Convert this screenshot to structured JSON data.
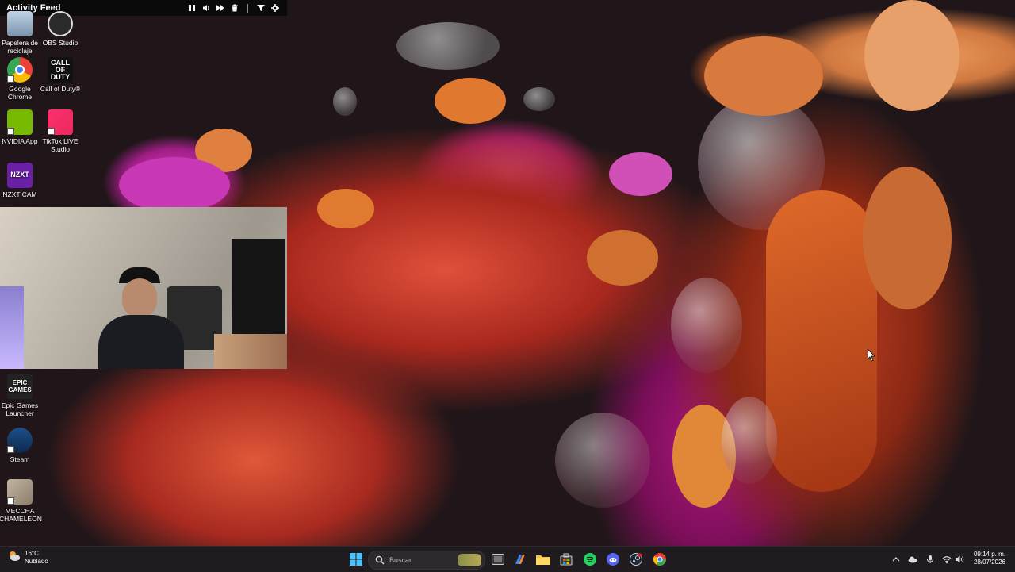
{
  "activity_feed": {
    "title": "Activity Feed",
    "controls": [
      "pause-icon",
      "volume-icon",
      "skip-icon",
      "trash-icon",
      "filter-icon",
      "gear-icon"
    ]
  },
  "desktop_icons": [
    {
      "label": "Papelera de reciclaje",
      "icon": "recycle-bin-icon"
    },
    {
      "label": "OBS Studio",
      "icon": "obs-icon"
    },
    {
      "label": "Google Chrome",
      "icon": "chrome-icon"
    },
    {
      "label": "Call of Duty®",
      "icon": "call-of-duty-icon",
      "logo_text": "CALL OF DUTY"
    },
    {
      "label": "NVIDIA App",
      "icon": "nvidia-icon"
    },
    {
      "label": "TikTok LIVE Studio",
      "icon": "tiktok-icon"
    },
    {
      "label": "NZXT CAM",
      "icon": "nzxt-icon",
      "logo_text": "NZXT"
    },
    {
      "label": "Epic Games Launcher",
      "icon": "epic-games-icon",
      "logo_text": "EPIC GAMES"
    },
    {
      "label": "Steam",
      "icon": "steam-icon"
    },
    {
      "label": "MECCHA CHAMELEON",
      "icon": "meccha-chameleon-icon"
    }
  ],
  "taskbar": {
    "weather": {
      "temp": "16°C",
      "condition": "Nublado"
    },
    "search_placeholder": "Buscar",
    "apps": [
      "windows-start-icon",
      "task-view-icon",
      "copilot-icon",
      "file-explorer-icon",
      "store-icon",
      "spotify-icon",
      "discord-icon",
      "steam-taskbar-icon",
      "chrome-taskbar-icon"
    ],
    "tray": [
      "chevron-up-icon",
      "onedrive-icon",
      "microphone-icon",
      "wifi-icon",
      "speaker-icon"
    ],
    "time": "09:14 p. m.",
    "date": "28/07/2026"
  },
  "colors": {
    "taskbar_bg": "#1f1b1e",
    "spotify": "#1ed760",
    "discord": "#5865f2",
    "nvidia": "#76b900",
    "nzxt": "#6b1fa6"
  }
}
